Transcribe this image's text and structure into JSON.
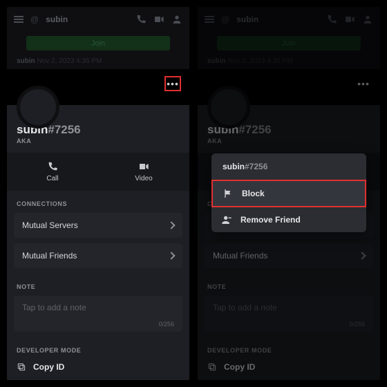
{
  "header": {
    "at": "@",
    "name": "subin"
  },
  "join_label": "Join",
  "msg_user": "subin",
  "msg_meta": "Nov 2, 2023 4:36 PM",
  "more_glyph": "•••",
  "profile": {
    "name": "subin",
    "hash": "#",
    "discriminator": "7256",
    "aka": "AKA"
  },
  "actions": {
    "call": "Call",
    "video": "Video"
  },
  "sections": {
    "connections": "CONNECTIONS",
    "mutual_servers": "Mutual Servers",
    "mutual_friends": "Mutual Friends",
    "note": "NOTE",
    "note_placeholder": "Tap to add a note",
    "note_counter": "0/256",
    "devmode": "DEVELOPER MODE",
    "copy_id": "Copy ID"
  },
  "menu": {
    "title_name": "subin",
    "title_disc": "#7256",
    "block": "Block",
    "remove_friend": "Remove Friend"
  }
}
